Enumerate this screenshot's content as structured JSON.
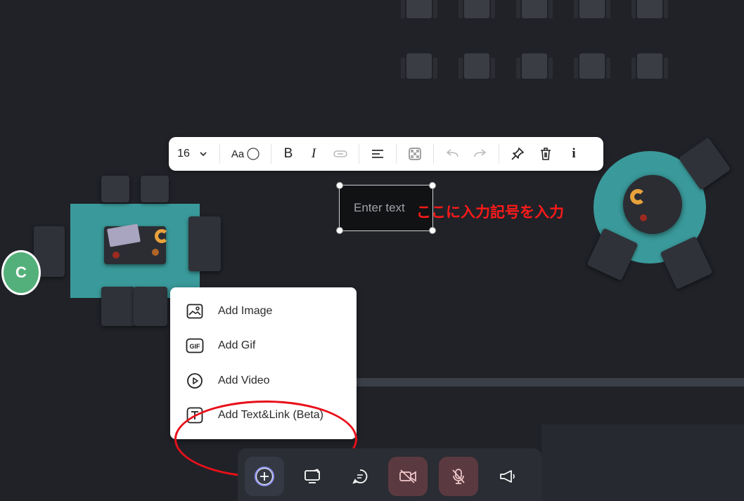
{
  "toolbar": {
    "font_size": "16",
    "font_label": "Aa",
    "bold": "B",
    "italic": "I",
    "info": "i"
  },
  "textbox": {
    "placeholder": "Enter text",
    "annotation": "ここに入力記号を入力"
  },
  "avatar": {
    "initial": "C"
  },
  "add_menu": {
    "items": [
      {
        "label": "Add Image",
        "icon": "image-icon"
      },
      {
        "label": "Add Gif",
        "icon": "gif-icon"
      },
      {
        "label": "Add Video",
        "icon": "video-play-icon"
      },
      {
        "label": "Add Text&Link (Beta)",
        "icon": "text-link-icon"
      }
    ]
  },
  "bottom_bar": {
    "buttons": [
      {
        "name": "add-button",
        "icon": "plus-icon"
      },
      {
        "name": "screen-share-button",
        "icon": "screen-share-icon"
      },
      {
        "name": "chat-button",
        "icon": "chat-icon"
      },
      {
        "name": "camera-button",
        "icon": "camera-off-icon",
        "state": "off"
      },
      {
        "name": "microphone-button",
        "icon": "mic-off-icon",
        "state": "off"
      },
      {
        "name": "announce-button",
        "icon": "megaphone-icon"
      }
    ]
  },
  "colors": {
    "background": "#202228",
    "teal_rug": "#3a9a9b",
    "annotation_red": "#ff1a1a",
    "avatar_green": "#54b07a",
    "off_button": "#5a3a40",
    "accent_ring": "#5b6cff"
  }
}
